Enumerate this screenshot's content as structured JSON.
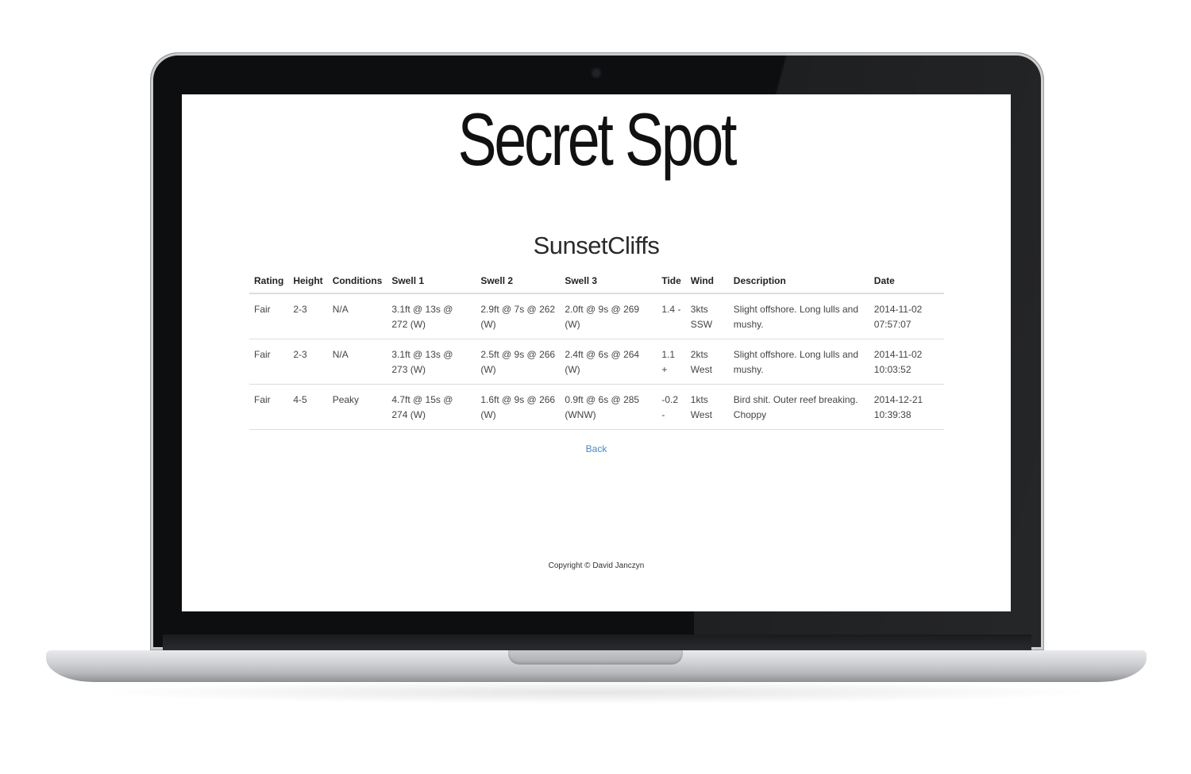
{
  "site": {
    "title": "Secret Spot"
  },
  "spot": {
    "name": "SunsetCliffs"
  },
  "table": {
    "headers": [
      "Rating",
      "Height",
      "Conditions",
      "Swell 1",
      "Swell 2",
      "Swell 3",
      "Tide",
      "Wind",
      "Description",
      "Date"
    ],
    "rows": [
      {
        "rating": "Fair",
        "height": "2-3",
        "conditions": "N/A",
        "swell1": "3.1ft @ 13s @ 272 (W)",
        "swell2": "2.9ft @ 7s @ 262 (W)",
        "swell3": "2.0ft @ 9s @ 269 (W)",
        "tide": "1.4 -",
        "wind": "3kts SSW",
        "description": "Slight offshore. Long lulls and mushy.",
        "date": "2014-11-02 07:57:07"
      },
      {
        "rating": "Fair",
        "height": "2-3",
        "conditions": "N/A",
        "swell1": "3.1ft @ 13s @ 273 (W)",
        "swell2": "2.5ft @ 9s @ 266 (W)",
        "swell3": "2.4ft @ 6s @ 264 (W)",
        "tide": "1.1 +",
        "wind": "2kts West",
        "description": "Slight offshore. Long lulls and mushy.",
        "date": "2014-11-02 10:03:52"
      },
      {
        "rating": "Fair",
        "height": "4-5",
        "conditions": "Peaky",
        "swell1": "4.7ft @ 15s @ 274 (W)",
        "swell2": "1.6ft @ 9s @ 266 (W)",
        "swell3": "0.9ft @ 6s @ 285 (WNW)",
        "tide": "-0.2 -",
        "wind": "1kts West",
        "description": "Bird shit. Outer reef breaking. Choppy",
        "date": "2014-12-21 10:39:38"
      }
    ]
  },
  "nav": {
    "back_label": "Back"
  },
  "footer": {
    "copyright": "Copyright © David Janczyn"
  },
  "colors": {
    "link": "#428bca",
    "laptop_bezel": "#0d0e10",
    "laptop_base": "#d2d4d7"
  }
}
